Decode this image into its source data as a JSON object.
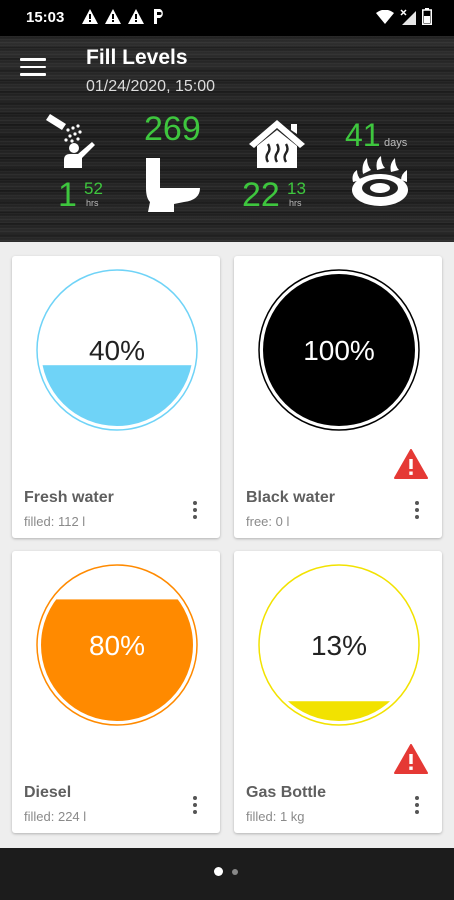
{
  "status": {
    "time": "15:03"
  },
  "header": {
    "title": "Fill Levels",
    "datetime": "01/24/2020, 15:00",
    "shower": {
      "value": "1",
      "sub": "52",
      "unit": "hrs"
    },
    "toilet": {
      "value": "269"
    },
    "heating": {
      "value": "22",
      "sub": "13",
      "unit": "hrs"
    },
    "stove": {
      "value": "41",
      "unit": "days"
    }
  },
  "tanks": [
    {
      "name": "Fresh water",
      "detail": "filled: 112 l",
      "percent_label": "40%",
      "level": 0.4,
      "color": "#6fd3f7",
      "ring": "#6fd3f7",
      "alert": false
    },
    {
      "name": "Black water",
      "detail": "free: 0 l",
      "percent_label": "100%",
      "level": 1.0,
      "color": "#000000",
      "ring": "#000000",
      "alert": true
    },
    {
      "name": "Diesel",
      "detail": "filled: 224 l",
      "percent_label": "80%",
      "level": 0.8,
      "color": "#ff8a00",
      "ring": "#ff8a00",
      "alert": false
    },
    {
      "name": "Gas Bottle",
      "detail": "filled: 1 kg",
      "percent_label": "13%",
      "level": 0.13,
      "color": "#f2e200",
      "ring": "#f2e200",
      "alert": true
    }
  ],
  "colors": {
    "accent_green": "#3ec63e",
    "alert_red": "#e53935"
  },
  "pager": {
    "pages": 2,
    "current": 1
  }
}
